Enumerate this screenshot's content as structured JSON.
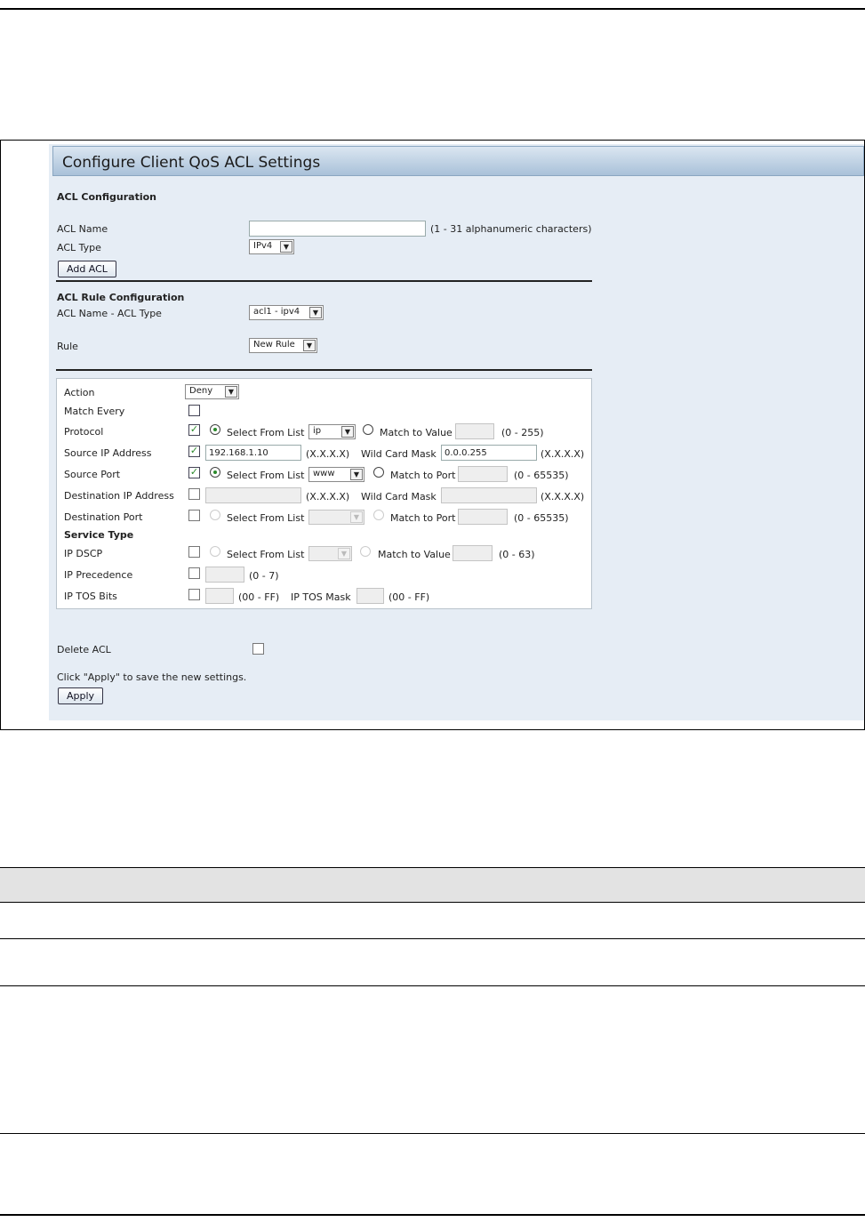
{
  "title": "Configure Client QoS ACL Settings",
  "acl_config": {
    "heading": "ACL Configuration",
    "acl_name_label": "ACL Name",
    "acl_name_value": "",
    "acl_name_hint": "(1 - 31 alphanumeric characters)",
    "acl_type_label": "ACL Type",
    "acl_type_value": "IPv4",
    "add_acl_button": "Add ACL"
  },
  "rule_config": {
    "heading": "ACL Rule Configuration",
    "name_type_label": "ACL Name - ACL Type",
    "name_type_value": "acl1 - ipv4",
    "rule_label": "Rule",
    "rule_value": "New Rule"
  },
  "rule": {
    "action_label": "Action",
    "action_value": "Deny",
    "match_every_label": "Match Every",
    "protocol": {
      "label": "Protocol",
      "select_from_list": "Select From List",
      "list_value": "ip",
      "match_to_value": "Match to Value",
      "value": "",
      "range": "(0 - 255)"
    },
    "source_ip": {
      "label": "Source IP Address",
      "value": "192.168.1.10",
      "format": "(X.X.X.X)",
      "mask_label": "Wild Card Mask",
      "mask_value": "0.0.0.255",
      "mask_format": "(X.X.X.X)"
    },
    "source_port": {
      "label": "Source Port",
      "select_from_list": "Select From List",
      "list_value": "www",
      "match_to_port": "Match to Port",
      "value": "",
      "range": "(0 - 65535)"
    },
    "dest_ip": {
      "label": "Destination IP Address",
      "value": "",
      "format": "(X.X.X.X)",
      "mask_label": "Wild Card Mask",
      "mask_value": "",
      "mask_format": "(X.X.X.X)"
    },
    "dest_port": {
      "label": "Destination Port",
      "select_from_list": "Select From List",
      "list_value": "",
      "match_to_port": "Match to Port",
      "value": "",
      "range": "(0 - 65535)"
    },
    "service_type_heading": "Service Type",
    "ip_dscp": {
      "label": "IP DSCP",
      "select_from_list": "Select From List",
      "list_value": "",
      "match_to_value": "Match to Value",
      "value": "",
      "range": "(0 - 63)"
    },
    "ip_precedence": {
      "label": "IP Precedence",
      "value": "",
      "range": "(0 - 7)"
    },
    "ip_tos": {
      "label": "IP TOS Bits",
      "value": "",
      "range": "(00 - FF)",
      "mask_label": "IP TOS Mask",
      "mask_value": "",
      "mask_range": "(00 - FF)"
    }
  },
  "delete_acl_label": "Delete ACL",
  "apply_hint": "Click \"Apply\" to save the new settings.",
  "apply_button": "Apply",
  "colors": {
    "panel_bg": "#e6edf5",
    "title_bar": "#a9c1d9",
    "check_green": "#2a8a2a"
  }
}
